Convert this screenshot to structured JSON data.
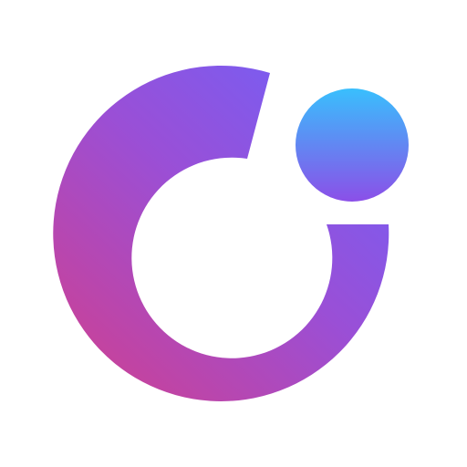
{
  "logo": {
    "icon_name": "gradient-ring-with-dot-icon",
    "colors": {
      "background": "#ffffff",
      "ring_start": "#c4439f",
      "ring_mid": "#9a4fd6",
      "ring_end": "#7b5cf0",
      "dot_top": "#39bffd",
      "dot_bottom": "#8b4fe8"
    }
  }
}
